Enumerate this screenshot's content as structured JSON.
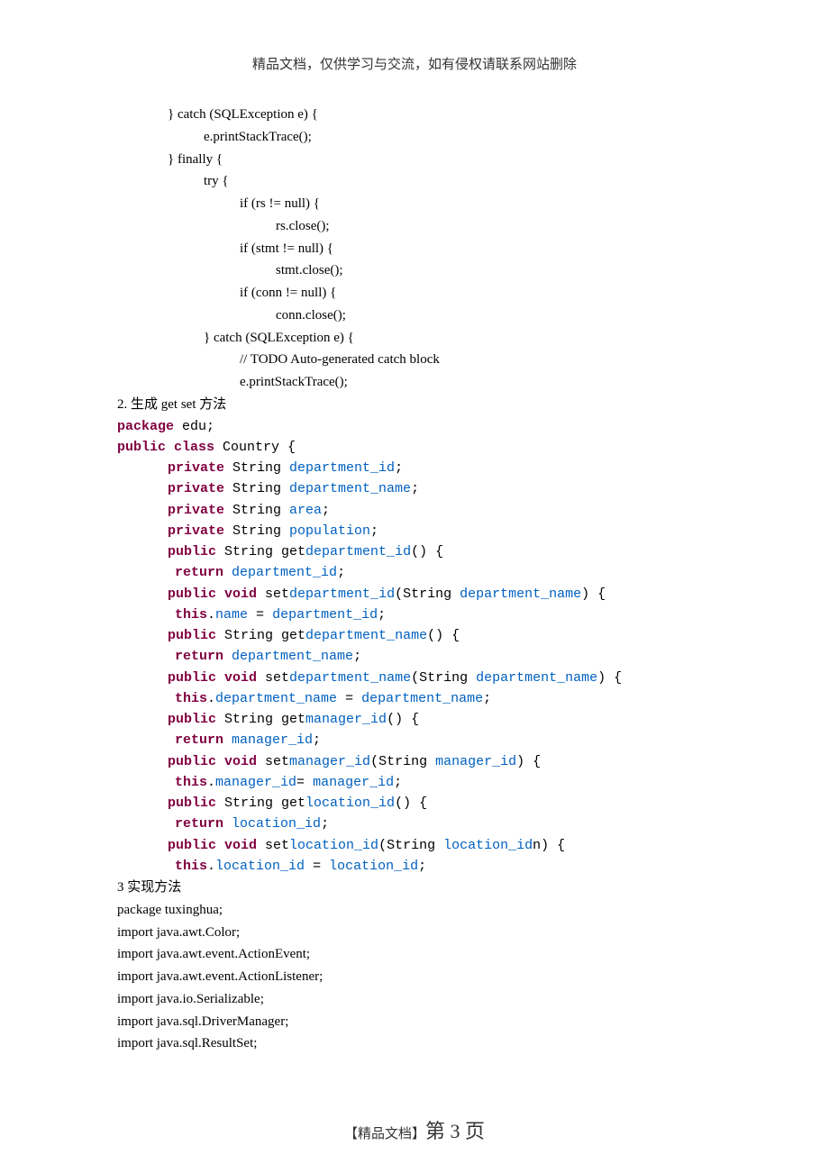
{
  "header": "精品文档，仅供学习与交流，如有侵权请联系网站删除",
  "top_code": {
    "l1": "} catch (SQLException e) {",
    "l2": "e.printStackTrace();",
    "l3": "} finally {",
    "l4": "try {",
    "l5": "if (rs != null) {",
    "l6": "rs.close();",
    "l7": "if (stmt != null) {",
    "l8": "stmt.close();",
    "l9": "if (conn != null) {",
    "l10": "conn.close();",
    "l11": "} catch (SQLException e) {",
    "l12": "// TODO Auto-generated catch block",
    "l13": "e.printStackTrace();"
  },
  "section2_heading_prefix": "2.   生成 get set",
  "section2_heading_suffix": " 方法",
  "java": {
    "pkg_kw": "package",
    "pkg_name": " edu;",
    "cls_kw1": "public",
    "cls_kw2": " class",
    "cls_name": " Country {",
    "f1_kw": "private",
    "f1_type": " String ",
    "f1_name": "department_id",
    "semi": ";",
    "f2_kw": "private",
    "f2_type": " String ",
    "f2_name": "department_name",
    "f3_kw": "private",
    "f3_type": " String ",
    "f3_name": "area",
    "f4_kw": "private",
    "f4_type": " String ",
    "f4_name": "population",
    "g1_kw": "public",
    "g1_sig": " String get",
    "g1_m": "department_id",
    "g1_paren": "() {",
    "ret_kw": "return",
    "sp": " ",
    "g1_ret": "department_id",
    "s1_kw": "public",
    "void_kw": " void",
    "s1_sig": " set",
    "s1_m": "department_id",
    "s1_p1": "(String ",
    "s1_pn": "department_name",
    "s1_p2": ") {",
    "this_kw": "this",
    "dot": ".",
    "s1_lhs": "name",
    "eq": " = ",
    "s1_rhs": "department_id",
    "g2_m": "department_name",
    "g2_ret": "department_name",
    "s2_m": "department_name",
    "s2_pn": "department_name",
    "s2_lhs": "department_name",
    "s2_rhs": "department_name",
    "g3_m": "manager_id",
    "g3_ret": "manager_id",
    "s3_m": "manager_id",
    "s3_pn": "manager_id",
    "s3_lhs": "manager_id",
    "s3_eqnosp": "= ",
    "s3_rhs": "manager_id",
    "g4_m": "location_id",
    "g4_ret": "location_id",
    "s4_m": "location_id",
    "s4_pn": "location_id",
    "s4_psuffix": "n) {",
    "s4_lhs": "location_id",
    "s4_rhs": "location_id"
  },
  "section3_heading": "3 实现方法",
  "bottom_code": {
    "l1": "package tuxinghua;",
    "l2": "import java.awt.Color;",
    "l3": "import java.awt.event.ActionEvent;",
    "l4": "import java.awt.event.ActionListener;",
    "l5": "import java.io.Serializable;",
    "l6": "import java.sql.DriverManager;",
    "l7": "import java.sql.ResultSet;"
  },
  "footer": {
    "brand": "【精品文档】",
    "page_word": "第 3 页"
  }
}
